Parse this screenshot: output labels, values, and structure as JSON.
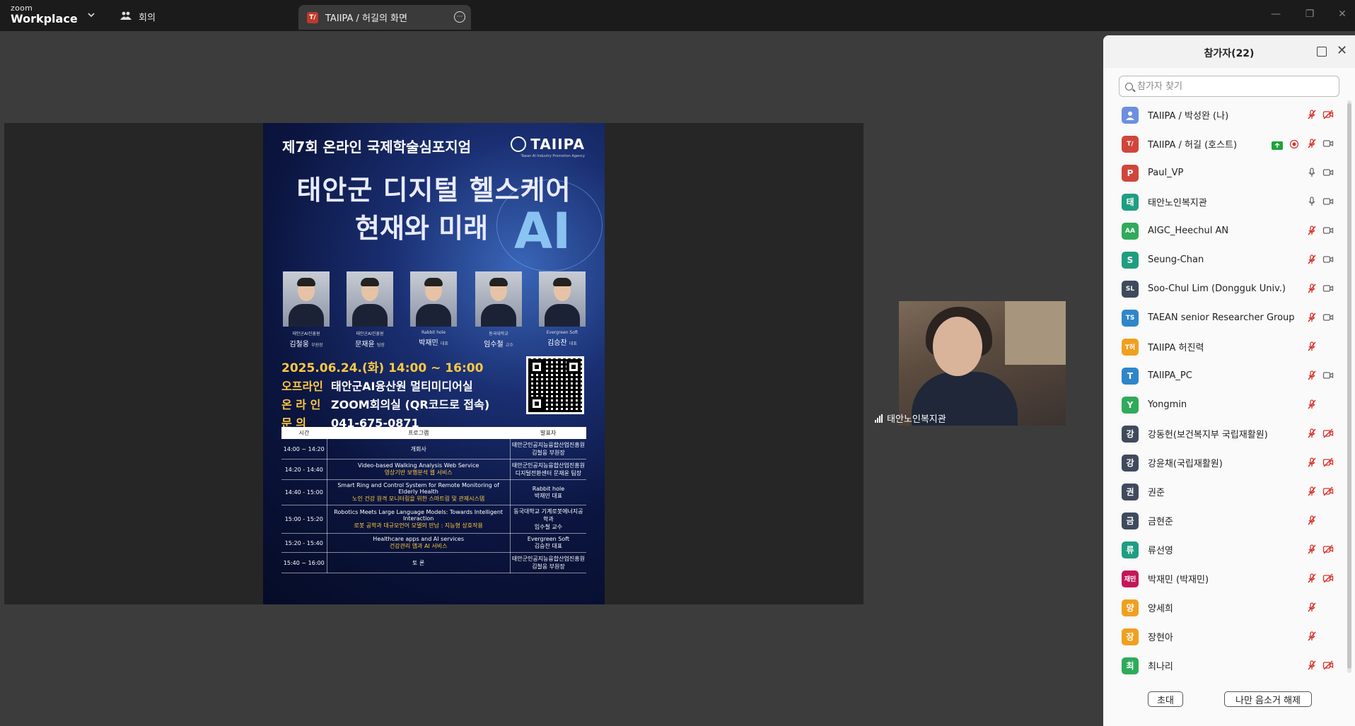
{
  "app": {
    "logo_small": "zoom",
    "logo_big": "Workplace",
    "meeting_tab": "회의",
    "share_tab": "TAIIPA / 허길의 화면",
    "share_tab_badge": "T/"
  },
  "poster": {
    "header": "제7회 온라인 국제학술심포지엄",
    "org_name": "TAIIPA",
    "org_sub": "Taean AI Industry Promotion Agency",
    "title_line1": "태안군 디지털 헬스케어",
    "title_line2": "현재와 미래",
    "ai_text": "AI",
    "speakers": [
      {
        "org": "태안군AI진흥원",
        "name": "김철웅",
        "role": "부원장"
      },
      {
        "org": "태안군AI진흥원",
        "name": "문재윤",
        "role": "팀장"
      },
      {
        "org": "Rabbit hole",
        "name": "박재민",
        "role": "대표"
      },
      {
        "org": "동국대학교",
        "name": "임수철",
        "role": "교수"
      },
      {
        "org": "Evergreen Soft",
        "name": "김승찬",
        "role": "대표"
      }
    ],
    "date": "2025.06.24.(화) 14:00 ~ 16:00",
    "offline_label": "오프라인",
    "offline_value": "태안군AI융산원 멀티미디어실",
    "online_label": "온 라 인",
    "online_value": "ZOOM회의실 (QR코드로 접속)",
    "contact_label": "문     의",
    "contact_value": "041-675-0871",
    "schedule_headers": [
      "시간",
      "프로그램",
      "발표자"
    ],
    "schedule": [
      {
        "time": "14:00 ~ 14:20",
        "program": "개회사",
        "program_kr": "",
        "presenter1": "태안군인공지능융합산업진흥원",
        "presenter2": "김철웅 부원장"
      },
      {
        "time": "14:20 - 14:40",
        "program": "Video-based Walking Analysis Web Service",
        "program_kr": "영상기반 보행분석 웹 서비스",
        "presenter1": "태안군인공지능융합산업진흥원",
        "presenter2": "디지털전환센터 문재윤 팀장"
      },
      {
        "time": "14:40 - 15:00",
        "program": "Smart Ring and Control System for Remote Monitoring of Elderly Health",
        "program_kr": "노인 건강 원격 모니터링을 위한 스마트링 및 관제시스템",
        "presenter1": "Rabbit hole",
        "presenter2": "박재민 대표"
      },
      {
        "time": "15:00 - 15:20",
        "program": "Robotics Meets Large Language Models: Towards Intelligent Interaction",
        "program_kr": "로봇 공학과 대규모언어 모델의 만남 : 지능형 상호작용",
        "presenter1": "동국대학교 기계로봇에너지공학과",
        "presenter2": "임수철 교수"
      },
      {
        "time": "15:20 - 15:40",
        "program": "Healthcare apps and AI services",
        "program_kr": "건강관리 앱과 AI 서비스",
        "presenter1": "Evergreen Soft",
        "presenter2": "김승찬 대표"
      },
      {
        "time": "15:40 ~ 16:00",
        "program": "토 론",
        "program_kr": "",
        "presenter1": "태안군인공지능융합산업진흥원",
        "presenter2": "김철웅 부원장"
      }
    ]
  },
  "video": {
    "label": "태안노인복지관"
  },
  "panel": {
    "title": "참가자(22)",
    "search_placeholder": "참가자 찾기",
    "invite_button": "초대",
    "unmute_me_button": "나만 음소거 해제",
    "participants": [
      {
        "avatar": "",
        "color": "#6d8fe0",
        "name": "TAIIPA / 박성완 (나)",
        "mic": "muted",
        "video": "off",
        "share": false,
        "record": false
      },
      {
        "avatar": "T/",
        "color": "#d0463b",
        "name": "TAIIPA / 허길 (호스트)",
        "mic": "muted",
        "video": "on",
        "share": true,
        "record": true
      },
      {
        "avatar": "P",
        "color": "#d0463b",
        "name": "Paul_VP",
        "mic": "on",
        "video": "on",
        "share": false,
        "record": false
      },
      {
        "avatar": "태",
        "color": "#1f9e82",
        "name": "태안노인복지관",
        "mic": "on",
        "video": "on",
        "share": false,
        "record": false
      },
      {
        "avatar": "AA",
        "color": "#2fab5a",
        "name": "AIGC_Heechul AN",
        "mic": "muted",
        "video": "on",
        "share": false,
        "record": false
      },
      {
        "avatar": "S",
        "color": "#1f9e82",
        "name": "Seung-Chan",
        "mic": "muted",
        "video": "on",
        "share": false,
        "record": false
      },
      {
        "avatar": "SL",
        "color": "#3f4a5c",
        "name": "Soo-Chul Lim (Dongguk Univ.)",
        "mic": "muted",
        "video": "on",
        "share": false,
        "record": false
      },
      {
        "avatar": "TS",
        "color": "#2f86c9",
        "name": "TAEAN senior Researcher Group",
        "mic": "muted",
        "video": "on",
        "share": false,
        "record": false
      },
      {
        "avatar": "T허",
        "color": "#f0a020",
        "name": "TAIIPA 허진력",
        "mic": "muted",
        "video": "none",
        "share": false,
        "record": false
      },
      {
        "avatar": "T",
        "color": "#2f86c9",
        "name": "TAIIPA_PC",
        "mic": "muted",
        "video": "on",
        "share": false,
        "record": false
      },
      {
        "avatar": "Y",
        "color": "#2fab5a",
        "name": "Yongmin",
        "mic": "muted",
        "video": "none",
        "share": false,
        "record": false
      },
      {
        "avatar": "강",
        "color": "#3f4a5c",
        "name": "강동헌(보건복지부 국립재활원)",
        "mic": "muted",
        "video": "off",
        "share": false,
        "record": false
      },
      {
        "avatar": "강",
        "color": "#3f4a5c",
        "name": "강윤채(국립재활원)",
        "mic": "muted",
        "video": "off",
        "share": false,
        "record": false
      },
      {
        "avatar": "권",
        "color": "#3f4a5c",
        "name": "권준",
        "mic": "muted",
        "video": "off",
        "share": false,
        "record": false
      },
      {
        "avatar": "금",
        "color": "#3f4a5c",
        "name": "금현준",
        "mic": "muted",
        "video": "none",
        "share": false,
        "record": false
      },
      {
        "avatar": "류",
        "color": "#1f9e82",
        "name": "류선영",
        "mic": "muted",
        "video": "off",
        "share": false,
        "record": false
      },
      {
        "avatar": "재민",
        "color": "#c2185b",
        "name": "박재민 (박재민)",
        "mic": "muted",
        "video": "off",
        "share": false,
        "record": false
      },
      {
        "avatar": "양",
        "color": "#f0a020",
        "name": "양세희",
        "mic": "muted",
        "video": "none",
        "share": false,
        "record": false
      },
      {
        "avatar": "장",
        "color": "#f0a020",
        "name": "장현아",
        "mic": "muted",
        "video": "none",
        "share": false,
        "record": false
      },
      {
        "avatar": "최",
        "color": "#2fab5a",
        "name": "최나리",
        "mic": "muted",
        "video": "off",
        "share": false,
        "record": false
      }
    ]
  }
}
